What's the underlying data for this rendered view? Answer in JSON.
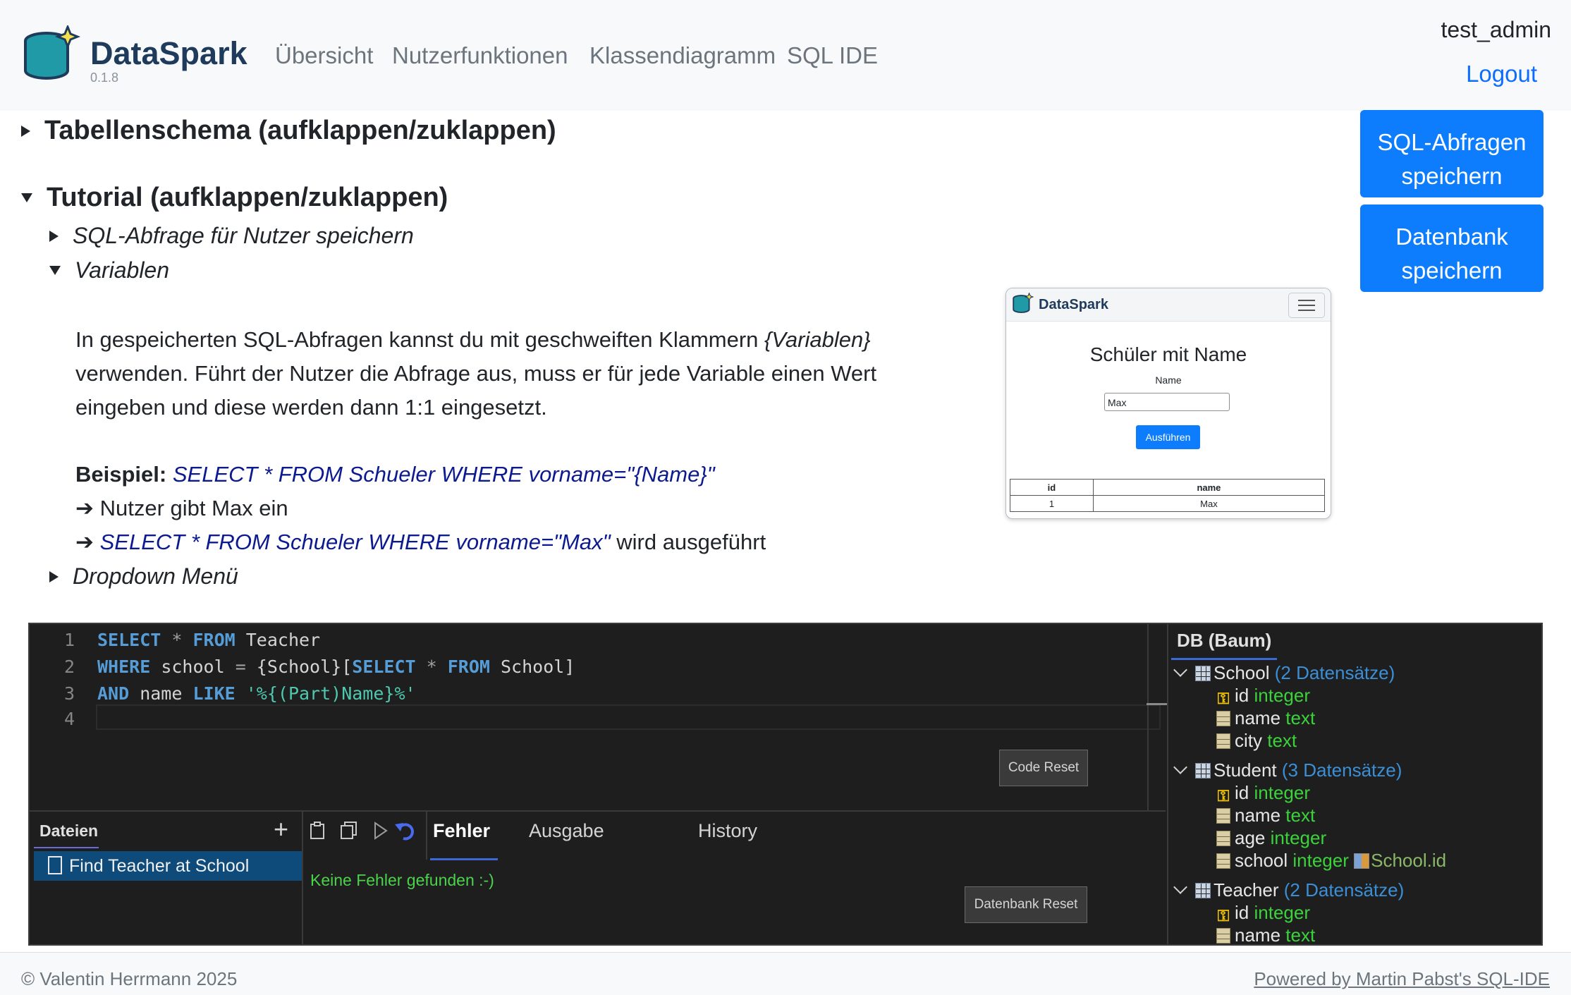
{
  "header": {
    "brand": "DataSpark",
    "version": "0.1.8",
    "nav": [
      "Übersicht",
      "Nutzerfunktionen",
      "Klassendiagramm",
      "SQL IDE"
    ],
    "user": "test_admin",
    "logout": "Logout"
  },
  "actions": {
    "save_queries": [
      "SQL-Abfragen",
      "speichern"
    ],
    "save_db": [
      "Datenbank",
      "speichern"
    ]
  },
  "content": {
    "schema_summary": "Tabellenschema (aufklappen/zuklappen)",
    "tutorial_summary": "Tutorial (aufklappen/zuklappen)",
    "sub_save": "SQL-Abfrage für Nutzer speichern",
    "sub_vars": "Variablen",
    "vars_text_1a": "In gespeicherten SQL-Abfragen kannst du mit geschweiften Klammern ",
    "vars_text_1b": "{Variablen}",
    "vars_text_2": "verwenden. Führt der Nutzer die Abfrage aus, muss er für jede Variable einen Wert",
    "vars_text_3": "eingeben und diese werden dann 1:1 eingesetzt.",
    "example_label": "Beispiel:",
    "example_query": "SELECT * FROM Schueler WHERE vorname=\"{Name}\"",
    "arrow": "➔",
    "step1": "Nutzer gibt Max ein",
    "step2_query": "SELECT * FROM Schueler WHERE vorname=\"Max\"",
    "step2_suffix": " wird ausgeführt",
    "sub_dropdown": "Dropdown Menü"
  },
  "preview": {
    "brand": "DataSpark",
    "title": "Schüler mit Name",
    "label": "Name",
    "input_value": "Max",
    "button": "Ausführen",
    "table_headers": [
      "id",
      "name"
    ],
    "table_row": [
      "1",
      "Max"
    ]
  },
  "ide": {
    "code_lines": [
      {
        "n": "1"
      },
      {
        "n": "2"
      },
      {
        "n": "3"
      },
      {
        "n": "4"
      }
    ],
    "code": {
      "l1_kw1": "SELECT",
      "l1_op": " * ",
      "l1_kw2": "FROM",
      "l1_id": " Teacher",
      "l2_kw1": "WHERE",
      "l2_id1": " school ",
      "l2_op": "=",
      "l2_id2": " {School}[",
      "l2_kw2": "SELECT",
      "l2_op2": " * ",
      "l2_kw3": "FROM",
      "l2_id3": " School]",
      "l3_kw1": "AND",
      "l3_id": " name ",
      "l3_kw2": "LIKE",
      "l3_str": " '%{(Part)Name}%'"
    },
    "code_reset": "Code Reset",
    "files_title": "Dateien",
    "file_item": "Find Teacher at School",
    "tabs": [
      "Fehler",
      "Ausgabe",
      "History"
    ],
    "no_errors": "Keine Fehler gefunden :-)",
    "db_reset": "Datenbank Reset",
    "tree_title": "DB (Baum)",
    "tables": [
      {
        "name": "School",
        "count": "(2 Datensätze)",
        "cols": [
          [
            "id",
            "integer"
          ],
          [
            "name",
            "text"
          ],
          [
            "city",
            "text"
          ]
        ]
      },
      {
        "name": "Student",
        "count": "(3 Datensätze)",
        "cols": [
          [
            "id",
            "integer"
          ],
          [
            "name",
            "text"
          ],
          [
            "age",
            "integer"
          ],
          [
            "school",
            "integer"
          ]
        ],
        "fk": "School.id"
      },
      {
        "name": "Teacher",
        "count": "(2 Datensätze)",
        "cols": [
          [
            "id",
            "integer"
          ],
          [
            "name",
            "text"
          ]
        ]
      }
    ]
  },
  "footer": {
    "copyright": "© Valentin Herrmann 2025",
    "powered": "Powered by Martin Pabst's SQL-IDE"
  }
}
